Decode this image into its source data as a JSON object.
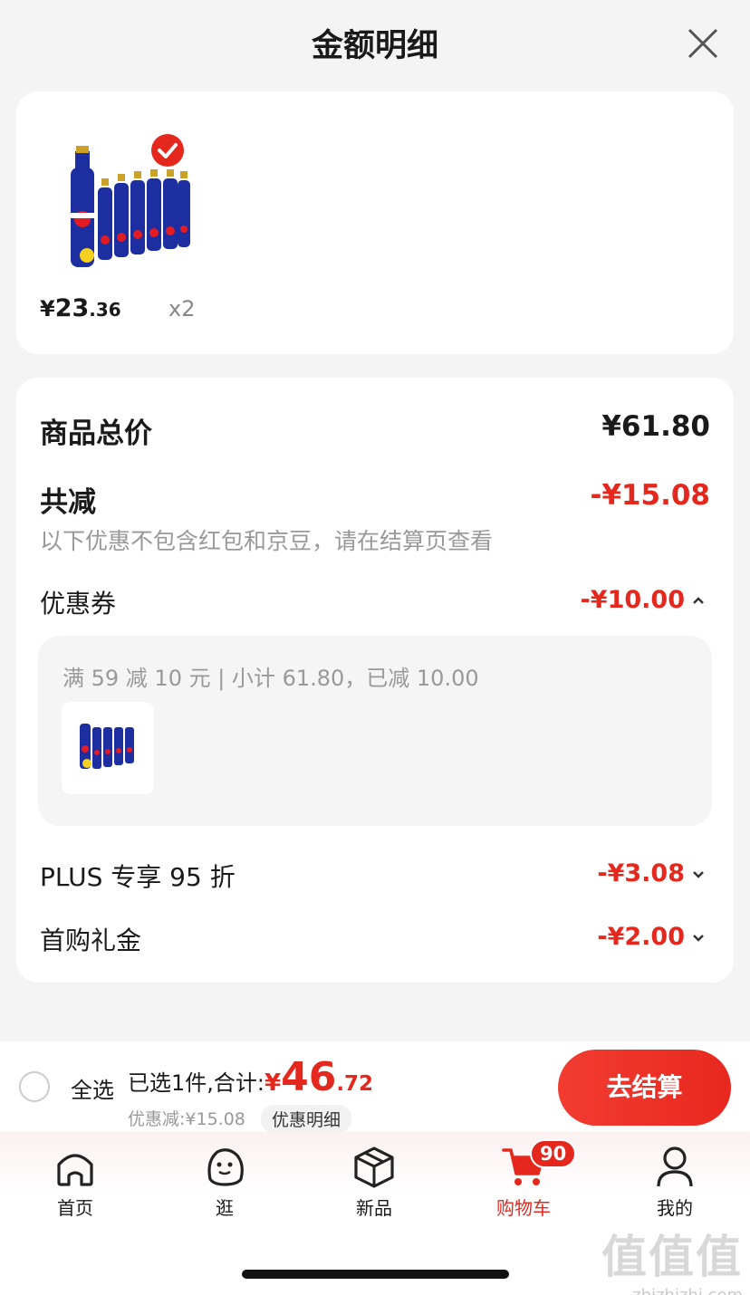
{
  "header": {
    "title": "金额明细"
  },
  "product": {
    "price_symbol": "¥",
    "price_int": "23",
    "price_dec": ".36",
    "quantity": "x2",
    "selected": true
  },
  "details": {
    "total_label": "商品总价",
    "total_value": "¥61.80",
    "reduce_label": "共减",
    "reduce_value": "-¥15.08",
    "reduce_note": "以下优惠不包含红包和京豆，请在结算页查看",
    "coupon_label": "优惠券",
    "coupon_value": "-¥10.00",
    "coupon_text": "满 59 减 10 元 | 小计 61.80，已减 10.00",
    "plus_label": "PLUS 专享 95 折",
    "plus_value": "-¥3.08",
    "gift_label": "首购礼金",
    "gift_value": "-¥2.00"
  },
  "bottom_bar": {
    "select_all": "全选",
    "summary": "已选1件,合计:",
    "total_symbol": "¥",
    "total_int": "46",
    "total_dec": ".72",
    "discount": "优惠减:¥15.08",
    "detail_link": "优惠明细",
    "checkout": "去结算"
  },
  "tabbar": {
    "items": [
      {
        "label": "首页",
        "icon": "home-icon"
      },
      {
        "label": "逛",
        "icon": "browse-icon"
      },
      {
        "label": "新品",
        "icon": "box-icon"
      },
      {
        "label": "购物车",
        "icon": "cart-icon",
        "badge": "90",
        "active": true
      },
      {
        "label": "我的",
        "icon": "user-icon"
      }
    ]
  },
  "watermark": {
    "logo": "值值值",
    "url": "zhizhizhi.com"
  },
  "colors": {
    "accent": "#e5281d",
    "background": "#f4f4f4"
  }
}
